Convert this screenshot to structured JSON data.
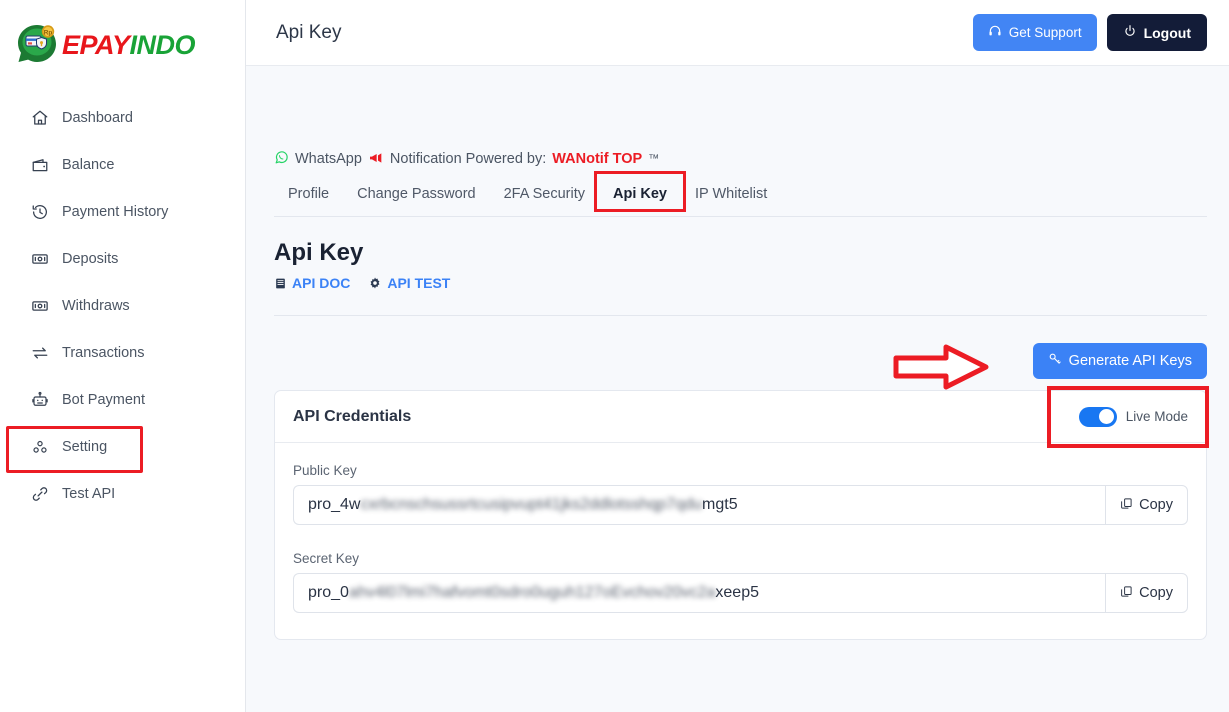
{
  "brand": {
    "name_part1": "EPAY",
    "name_part2": "INDO",
    "color_red": "#e8161b",
    "color_green": "#19a337"
  },
  "sidebar": {
    "items": [
      {
        "label": "Dashboard",
        "icon": "home-icon",
        "highlighted": false
      },
      {
        "label": "Balance",
        "icon": "wallet-icon",
        "highlighted": false
      },
      {
        "label": "Payment History",
        "icon": "clock-icon",
        "highlighted": false
      },
      {
        "label": "Deposits",
        "icon": "banknote-icon",
        "highlighted": false
      },
      {
        "label": "Withdraws",
        "icon": "banknote-icon",
        "highlighted": false
      },
      {
        "label": "Transactions",
        "icon": "exchange-icon",
        "highlighted": false
      },
      {
        "label": "Bot Payment",
        "icon": "robot-icon",
        "highlighted": false
      },
      {
        "label": "Setting",
        "icon": "settings-icon",
        "highlighted": true
      },
      {
        "label": "Test API",
        "icon": "link-icon",
        "highlighted": false
      }
    ]
  },
  "topbar": {
    "title": "Api Key",
    "support_label": "Get Support",
    "logout_label": "Logout",
    "support_color": "#4285f4",
    "logout_color": "#131c38"
  },
  "notice": {
    "whatsapp": "WhatsApp",
    "text": "Notification Powered by:",
    "brand": "WANotif TOP",
    "tm": "™",
    "brand_color": "#ec1c24"
  },
  "tabs": [
    {
      "label": "Profile",
      "active": false,
      "highlighted": false
    },
    {
      "label": "Change Password",
      "active": false,
      "highlighted": false
    },
    {
      "label": "2FA Security",
      "active": false,
      "highlighted": false
    },
    {
      "label": "Api Key",
      "active": true,
      "highlighted": true
    },
    {
      "label": "IP Whitelist",
      "active": false,
      "highlighted": false
    }
  ],
  "section": {
    "title": "Api Key",
    "doc_link": "API DOC",
    "test_link": "API TEST",
    "link_color": "#3b82f6"
  },
  "actions": {
    "generate_label": "Generate API Keys",
    "generate_color": "#3b82f6",
    "arrow_color": "#ec1c24"
  },
  "credentials": {
    "card_title": "API Credentials",
    "live_mode_label": "Live Mode",
    "live_mode_on": true,
    "toggle_color": "#1877f2",
    "public_key_label": "Public Key",
    "public_key_prefix": "pro_4w",
    "public_key_masked": "cxrbcnschsussrtcusipvupt41jks2ddlotsshqp7qdu",
    "public_key_suffix": "mgt5",
    "secret_key_label": "Secret Key",
    "secret_key_prefix": "pro_0",
    "secret_key_masked": "ahv4l07lmi7hafvomt0sdro0uguh127oEvchov20vc2a",
    "secret_key_suffix": "xeep5",
    "copy_label": "Copy"
  }
}
